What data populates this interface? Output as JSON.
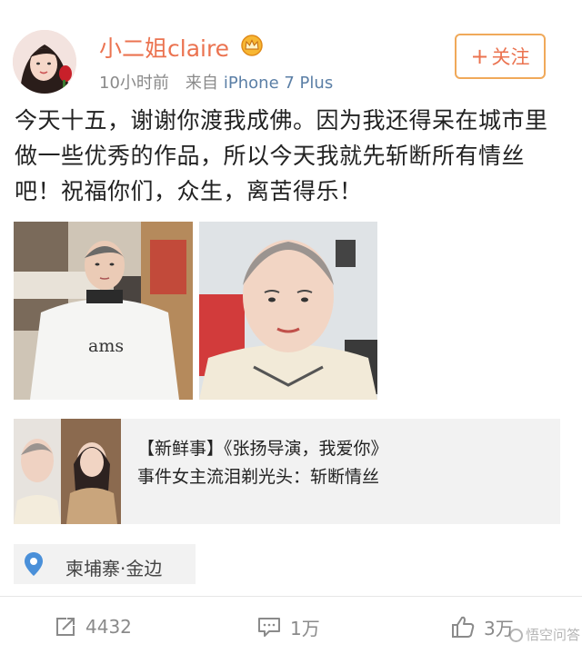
{
  "post": {
    "username": "小二姐claire",
    "time": "10小时前",
    "source_prefix": "来自",
    "device": "iPhone 7 Plus",
    "follow_label": "关注",
    "follow_plus": "+",
    "text": "今天十五，谢谢你渡我成佛。因为我还得呆在城市里做一些优秀的作品，所以今天我就先斩断所有情丝吧！祝福你们，众生，离苦得乐！",
    "photo1_label": "ams"
  },
  "repost_card": {
    "title": "【新鲜事】《张扬导演，我爱你》",
    "subtitle": "事件女主流泪剃光头：斩断情丝"
  },
  "location": {
    "text": "柬埔寨·金边"
  },
  "actions": {
    "repost_count": "4432",
    "comment_count": "1万",
    "like_count": "3万"
  },
  "watermark": {
    "text": "悟空问答"
  },
  "colors": {
    "username": "#eb7350",
    "follow_border": "#f0a95a",
    "device_link": "#5b7fa6"
  }
}
